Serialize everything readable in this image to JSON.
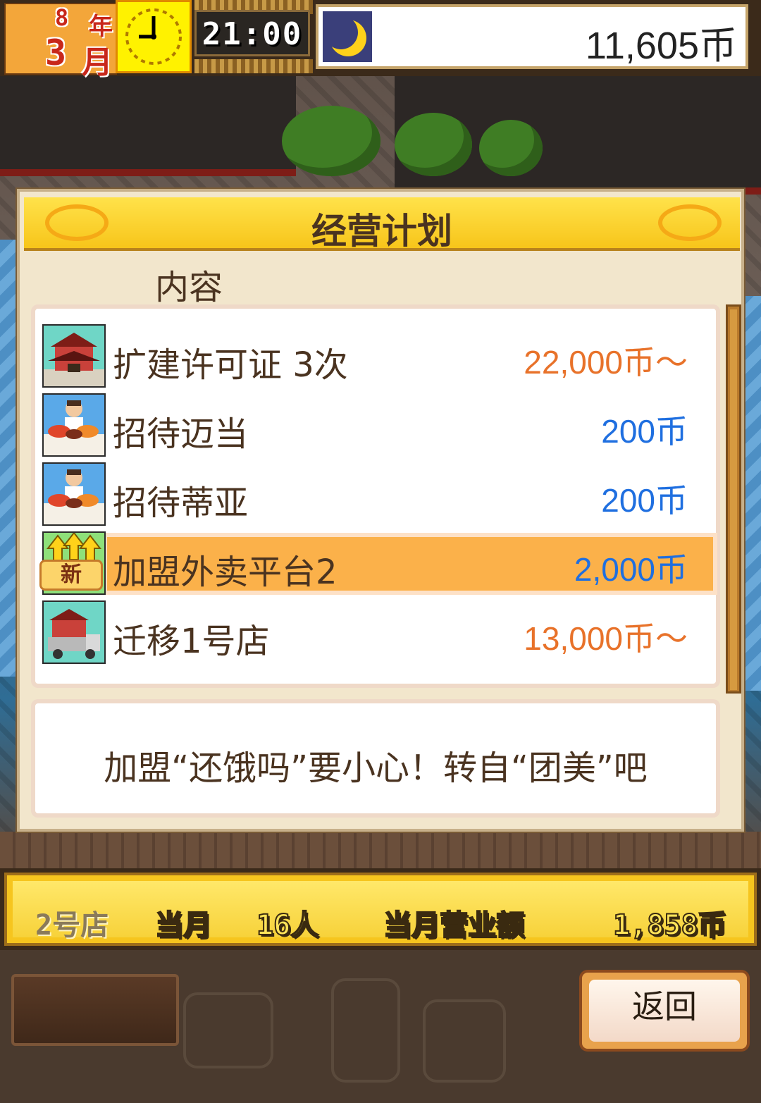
{
  "topbar": {
    "year_num": "8",
    "year_unit": "年",
    "month_num": "3",
    "month_unit": "月",
    "time": "21:00",
    "money": "11,605币"
  },
  "panel": {
    "title": "经营计划",
    "section_label": "内容",
    "items": [
      {
        "label": "扩建许可证 3次",
        "price": "22,000币〜",
        "price_color": "#e8722a"
      },
      {
        "label": "招待迈当",
        "price": "200币",
        "price_color": "#1f6fe0"
      },
      {
        "label": "招待蒂亚",
        "price": "200币",
        "price_color": "#1f6fe0"
      },
      {
        "label": "加盟外卖平台2",
        "price": "2,000币",
        "price_color": "#1f6fe0",
        "badge": "新"
      },
      {
        "label": "迁移1号店",
        "price": "13,000币〜",
        "price_color": "#e8722a"
      }
    ],
    "description": "加盟“还饿吗”要小心！转自“团美”吧"
  },
  "statusbar": {
    "store": "2号店",
    "month_label": "当月",
    "customers": "16人",
    "revenue_label": "当月营业额",
    "revenue": "1,858币"
  },
  "bottom": {
    "back_label": "返回"
  }
}
